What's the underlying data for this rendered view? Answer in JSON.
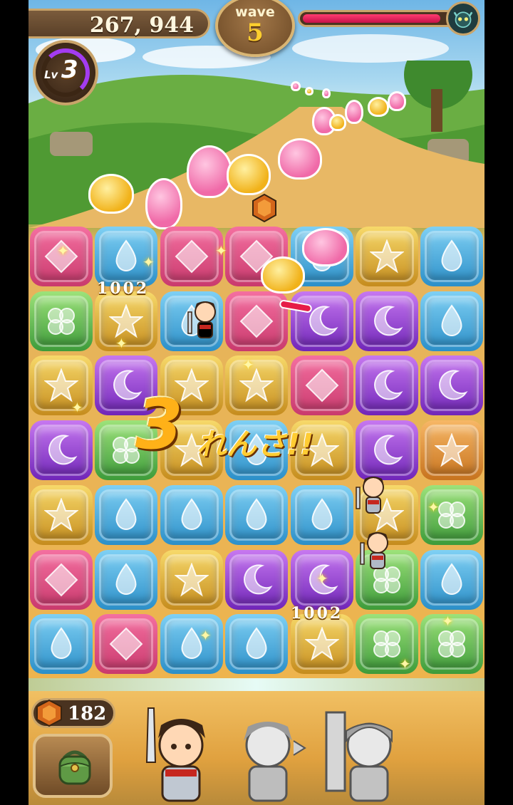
{
  "hud": {
    "score": "267, 944",
    "wave_label": "wave",
    "wave_number": "5",
    "enemy_hp_fraction": 0.93,
    "level_label": "Lv",
    "level_value": "3",
    "level_progress_fraction": 0.25
  },
  "board": {
    "rows": 7,
    "cols": 7,
    "tiles": [
      [
        "pink",
        "blue",
        "pink",
        "pink",
        "blue",
        "yellow",
        "blue"
      ],
      [
        "green",
        "yellow",
        "blue",
        "pink",
        "purple",
        "purple",
        "blue"
      ],
      [
        "yellow",
        "purple",
        "yellow",
        "yellow",
        "pink",
        "purple",
        "purple"
      ],
      [
        "purple",
        "green",
        "yellow",
        "blue",
        "yellow",
        "purple",
        "orange"
      ],
      [
        "yellow",
        "blue",
        "blue",
        "blue",
        "blue",
        "yellow",
        "green"
      ],
      [
        "pink",
        "blue",
        "yellow",
        "purple",
        "purple",
        "green",
        "blue"
      ],
      [
        "blue",
        "pink",
        "blue",
        "blue",
        "yellow",
        "green",
        "green"
      ]
    ],
    "damage_numbers": [
      "1002",
      "1002"
    ],
    "combo_number": "3",
    "combo_text": "れんさ!!"
  },
  "bottom": {
    "gem_count": "182",
    "heroes": [
      {
        "name": "swordsman",
        "active": true
      },
      {
        "name": "archer",
        "active": false
      },
      {
        "name": "knight",
        "active": false
      }
    ]
  },
  "icons": {
    "pink": "diamond-icon",
    "blue": "water-drop-icon",
    "green": "clover-icon",
    "yellow": "star-icon",
    "purple": "moon-icon",
    "orange": "star-icon"
  }
}
